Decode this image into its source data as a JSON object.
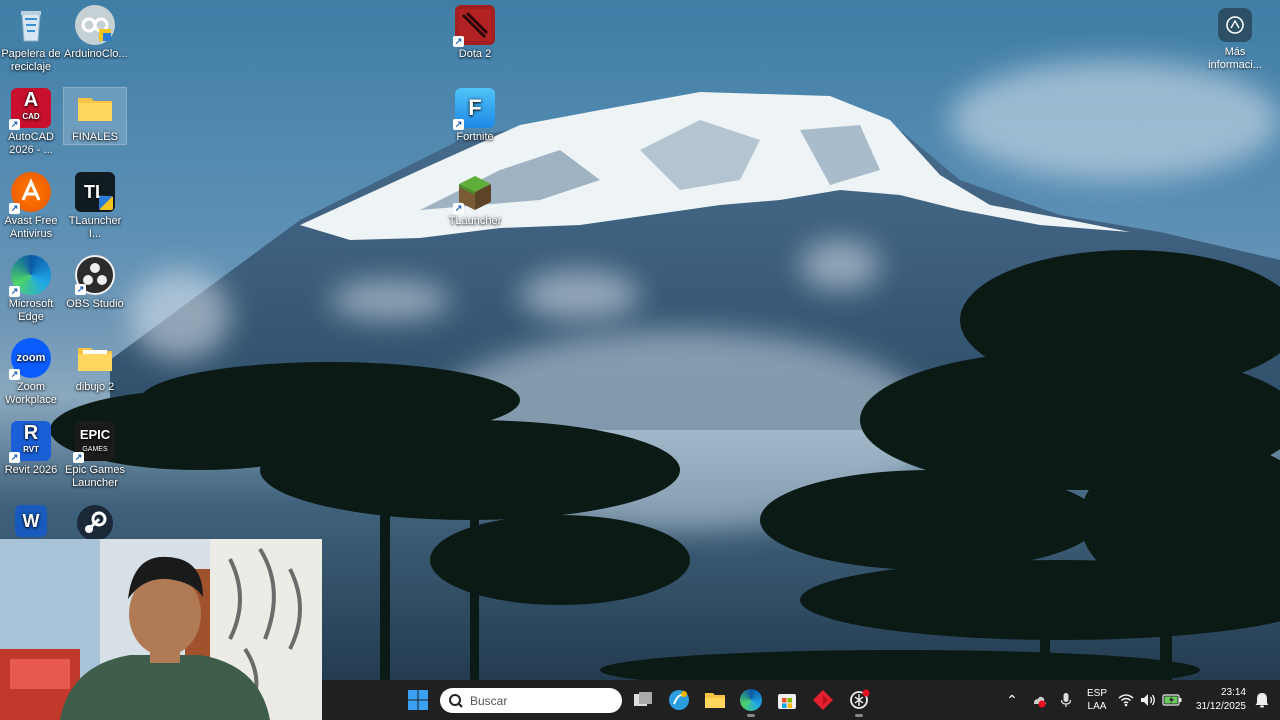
{
  "desktop_icons": [
    {
      "label": "Papelera de reciclaje",
      "icon": "recycle-bin-icon"
    },
    {
      "label": "ArduinoClo...",
      "icon": "arduino-cloud-icon"
    },
    {
      "label": "AutoCAD 2026 - ...",
      "icon": "autocad-icon",
      "badge": "A",
      "sub": "CAD"
    },
    {
      "label": "FINALES",
      "icon": "folder-icon"
    },
    {
      "label": "Avast Free Antivirus",
      "icon": "avast-icon"
    },
    {
      "label": "TLauncher I...",
      "icon": "tlauncher-icon",
      "badge": "TL"
    },
    {
      "label": "Microsoft Edge",
      "icon": "edge-icon"
    },
    {
      "label": "OBS Studio",
      "icon": "obs-icon"
    },
    {
      "label": "Zoom Workplace",
      "icon": "zoom-icon",
      "badge": "zoom"
    },
    {
      "label": "dibujo 2",
      "icon": "folder-icon"
    },
    {
      "label": "Revit 2026",
      "icon": "revit-icon",
      "badge": "R",
      "sub": "RVT"
    },
    {
      "label": "Epic Games Launcher",
      "icon": "epic-games-icon",
      "badge": "EPIC",
      "sub": "GAMES"
    },
    {
      "label": "",
      "icon": "word-icon",
      "badge": "W"
    },
    {
      "label": "",
      "icon": "steam-icon"
    },
    {
      "label": "Dota 2",
      "icon": "dota2-icon"
    },
    {
      "label": "Fortnite",
      "icon": "fortnite-icon",
      "badge": "F"
    },
    {
      "label": "TLauncher",
      "icon": "minecraft-grass-icon"
    }
  ],
  "info_widget": {
    "label": "Más informaci...",
    "icon": "camera-lens-icon"
  },
  "taskbar": {
    "start_icon": "windows-start-icon",
    "search_placeholder": "Buscar",
    "search_icon": "search-icon",
    "pinned": [
      "task-view-icon",
      "copilot-icon",
      "file-explorer-icon",
      "edge-icon",
      "microsoft-store-icon",
      "red-diamond-app-icon",
      "chatgpt-icon"
    ],
    "tray": {
      "chevron_icon": "chevron-up-icon",
      "language_top": "ESP",
      "language_bottom": "LAA",
      "time": "23:14",
      "date": "31/12/2025"
    }
  },
  "colors": {
    "taskbar_bg": "#202020",
    "accent": "#0078d4"
  }
}
